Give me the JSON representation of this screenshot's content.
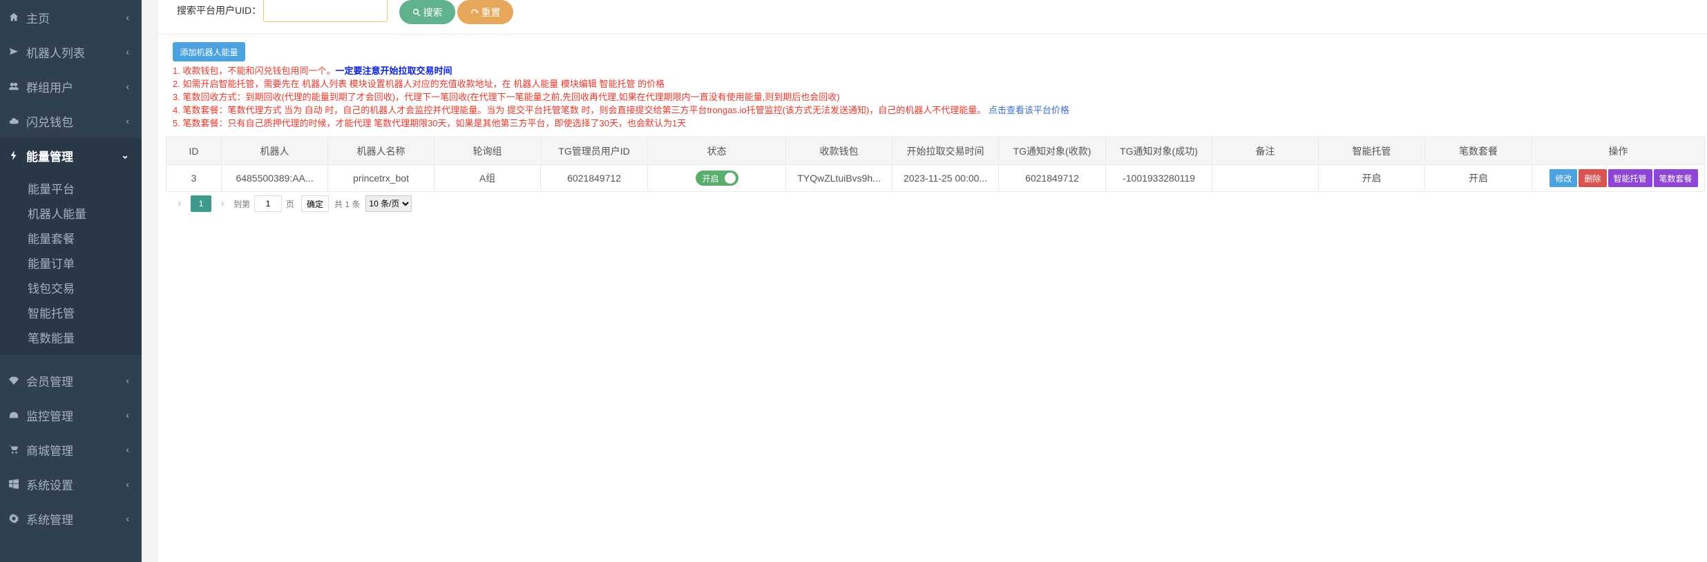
{
  "sidebar": {
    "items_top": [
      {
        "label": "主页",
        "icon": "home-icon"
      },
      {
        "label": "机器人列表",
        "icon": "plane-icon"
      },
      {
        "label": "群组用户",
        "icon": "users-icon"
      },
      {
        "label": "闪兑钱包",
        "icon": "cloud-icon"
      }
    ],
    "active": {
      "label": "能量管理",
      "icon": "bolt-icon"
    },
    "sub_items": [
      "能量平台",
      "机器人能量",
      "能量套餐",
      "能量订单",
      "钱包交易",
      "智能托管",
      "笔数能量"
    ],
    "items_bottom": [
      {
        "label": "会员管理",
        "icon": "diamond-icon"
      },
      {
        "label": "监控管理",
        "icon": "dashboard-icon"
      },
      {
        "label": "商城管理",
        "icon": "cart-icon"
      },
      {
        "label": "系统设置",
        "icon": "windows-icon"
      },
      {
        "label": "系统管理",
        "icon": "gear-icon"
      }
    ]
  },
  "search": {
    "label": "搜索平台用户UID：",
    "value": "",
    "placeholder": "",
    "search_label": "搜索",
    "reset_label": "重置"
  },
  "add_button": "添加机器人能量",
  "notes": {
    "n1_red": "1. 收款钱包，不能和闪兑钱包用同一个。",
    "n1_blue": "一定要注意开始拉取交易时间",
    "n2": "2. 如需开启智能托管，需要先在 机器人列表 模块设置机器人对应的充值收款地址，在 机器人能量 模块编辑 智能托管 的价格",
    "n3": "3. 笔数回收方式：到期回收(代理的能量到期了才会回收)，代理下一笔回收(在代理下一笔能量之前,先回收再代理,如果在代理期限内一直没有使用能量,则到期后也会回收)",
    "n4_red": "4. 笔数套餐：笔数代理方式 当为 自动 时，自己的机器人才会监控并代理能量。当为 提交平台托管笔数 时，则会直接提交给第三方平台trongas.io托管监控(该方式无法发送通知)，自己的机器人不代理能量。",
    "n4_link": "点击查看该平台价格",
    "n5": "5. 笔数套餐：只有自己质押代理的时候，才能代理 笔数代理期限30天，如果是其他第三方平台，即使选择了30天，也会默认为1天"
  },
  "table": {
    "headers": [
      "ID",
      "机器人",
      "机器人名称",
      "轮询组",
      "TG管理员用户ID",
      "状态",
      "收款钱包",
      "开始拉取交易时间",
      "TG通知对象(收款)",
      "TG通知对象(成功)",
      "备注",
      "智能托管",
      "笔数套餐",
      "操作"
    ],
    "rows": [
      {
        "id": "3",
        "bot": "6485500389:AA...",
        "bot_name": "princetrx_bot",
        "group": "A组",
        "tg_admin": "6021849712",
        "status": "开启",
        "wallet": "TYQwZLtuiBvs9h...",
        "start_time": "2023-11-25 00:00...",
        "notify_collect": "6021849712",
        "notify_success": "-1001933280119",
        "remark": "",
        "smart_hosting": "开启",
        "count_package": "开启",
        "actions": {
          "edit": "修改",
          "delete": "删除",
          "smart": "智能托管",
          "package": "笔数套餐"
        }
      }
    ]
  },
  "pagination": {
    "current": "1",
    "goto_label": "到第",
    "page_input": "1",
    "page_unit": "页",
    "confirm": "确定",
    "total": "共 1 条",
    "per_page": "10 条/页"
  }
}
